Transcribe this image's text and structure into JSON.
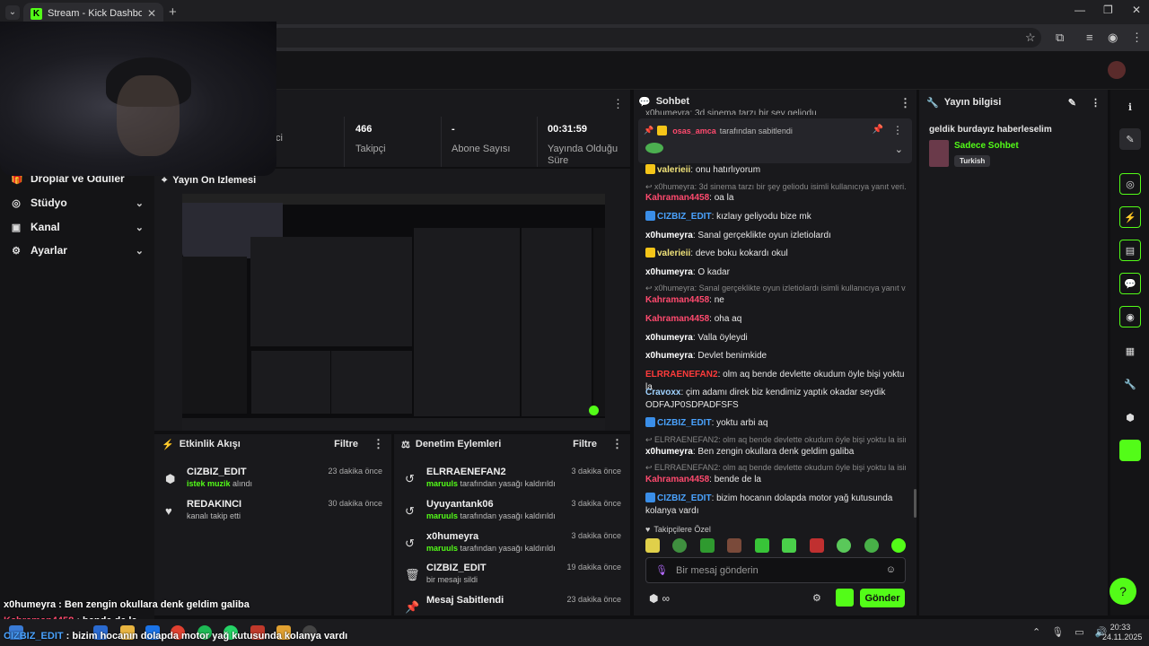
{
  "browser": {
    "tab_title": "Stream - Kick Dashboard",
    "new_tab": "+",
    "close": "✕"
  },
  "sidebar": {
    "items": [
      {
        "label": "Droplar ve Ödüller",
        "icon": "gift-icon"
      },
      {
        "label": "Stüdyo",
        "icon": "camera-icon"
      },
      {
        "label": "Kanal",
        "icon": "broadcast-icon"
      },
      {
        "label": "Ayarlar",
        "icon": "gear-icon"
      }
    ]
  },
  "stats": {
    "items": [
      {
        "value": "",
        "label": "İzleyici"
      },
      {
        "value": "466",
        "label": "Takipçi"
      },
      {
        "value": "-",
        "label": "Abone Sayısı"
      },
      {
        "value": "00:31:59",
        "label": "Yayında Olduğu Süre"
      }
    ]
  },
  "preview": {
    "title": "Yayın Ön İzlemesi"
  },
  "activity": {
    "title": "Etkinlik Akışı",
    "filter": "Filtre",
    "events": [
      {
        "name": "CIZBIZ_EDIT",
        "highlight": "istek muzik",
        "text": " alındı",
        "time": "23 dakika önce"
      },
      {
        "name": "REDAKINCI",
        "highlight": "",
        "text": "kanalı takip etti",
        "time": "30 dakika önce"
      }
    ]
  },
  "moderation": {
    "title": "Denetim Eylemleri",
    "filter": "Filtre",
    "events": [
      {
        "name": "ELRRAENEFAN2",
        "highlight": "maruuls",
        "text": " tarafından yasağı kaldırıldı",
        "time": "3 dakika önce"
      },
      {
        "name": "Uyuyantank06",
        "highlight": "maruuls",
        "text": " tarafından yasağı kaldırıldı",
        "time": "3 dakika önce"
      },
      {
        "name": "x0humeyra",
        "highlight": "maruuls",
        "text": " tarafından yasağı kaldırıldı",
        "time": "3 dakika önce"
      },
      {
        "name": "CIZBIZ_EDIT",
        "highlight": "",
        "text": "bir mesajı sildi",
        "time": "19 dakika önce"
      },
      {
        "name": "Mesaj Sabitlendi",
        "highlight": "",
        "text": "",
        "time": "23 dakika önce"
      }
    ]
  },
  "chat": {
    "title": "Sohbet",
    "pinned_user": "osas_amca",
    "pinned_text": "tarafından sabitlendi",
    "top_cut": "x0humeyra: 3d sinema tarzı bir şey geliodu",
    "messages": [
      {
        "user": "valerieii",
        "color": "#f1e37a",
        "text": ": onu hatırlıyorum",
        "badge": "crown"
      },
      {
        "reply": "x0humeyra: 3d sinema tarzı bir şey geliodu isimli kullanıcıya yanıt veri..."
      },
      {
        "user": "Kahraman4458",
        "color": "#ff4a6e",
        "text": ": oa la"
      },
      {
        "user": "CIZBIZ_EDIT",
        "color": "#4aa3ff",
        "text": ": kızlaıy geliyodu bize mk",
        "badge": "pencil"
      },
      {
        "user": "x0humeyra",
        "color": "#ffffff",
        "text": ": Sanal gerçeklikte oyun izletiolardı"
      },
      {
        "user": "valerieii",
        "color": "#f1e37a",
        "text": ": deve boku kokardı okul",
        "badge": "crown"
      },
      {
        "user": "x0humeyra",
        "color": "#ffffff",
        "text": ": O kadar"
      },
      {
        "reply": "x0humeyra: Sanal gerçeklikte oyun izletiolardı isimli kullanıcıya yanıt v..."
      },
      {
        "user": "Kahraman4458",
        "color": "#ff4a6e",
        "text": ": ne"
      },
      {
        "user": "Kahraman4458",
        "color": "#ff4a6e",
        "text": ": oha aq"
      },
      {
        "user": "x0humeyra",
        "color": "#ffffff",
        "text": ": Valla öyleydi"
      },
      {
        "user": "x0humeyra",
        "color": "#ffffff",
        "text": ": Devlet benimkide"
      },
      {
        "user": "ELRRAENEFAN2",
        "color": "#ff3b3b",
        "text": ": olm aq bende devlette okudum öyle bişi yoktu la"
      },
      {
        "user": "Cravoxx",
        "color": "#9fd2ff",
        "text": ": çim adamı direk biz kendimiz yaptık okadar seydik ODFAJP0SDPADFSFS"
      },
      {
        "user": "CIZBIZ_EDIT",
        "color": "#4aa3ff",
        "text": ": yoktu arbi aq",
        "badge": "pencil"
      },
      {
        "reply": "ELRRAENEFAN2: olm aq bende devlette okudum öyle bişi yoktu la isim..."
      },
      {
        "user": "x0humeyra",
        "color": "#ffffff",
        "text": ": Ben zengin okullara denk geldim galiba"
      },
      {
        "reply": "ELRRAENEFAN2: olm aq bende devlette okudum öyle bişi yoktu la isim..."
      },
      {
        "user": "Kahraman4458",
        "color": "#ff4a6e",
        "text": ": bende de la"
      },
      {
        "user": "CIZBIZ_EDIT",
        "color": "#4aa3ff",
        "text": ": bizim hocanın dolapda motor yağ kutusunda kolanya vardı",
        "badge": "pencil"
      }
    ],
    "emote_title": "Takipçilere Özel",
    "input_placeholder": "Bir mesaj gönderin",
    "send": "Gönder",
    "infinity": "∞"
  },
  "info": {
    "title": "Yayın bilgisi",
    "stream_title": "geldik burdayız haberleselim",
    "category": "Sadece Sohbet",
    "tag": "Turkish"
  },
  "overlay": {
    "lines": [
      {
        "user": "x0humeyra",
        "text": " : Ben zengin okullara denk geldim galiba"
      },
      {
        "user": "Kahraman4458",
        "text": " : bende de la"
      },
      {
        "user": "CIZBIZ_EDIT",
        "text": " : bizim hocanın dolapda motor yağ kutusunda kolanya vardı"
      }
    ]
  },
  "taskbar": {
    "time": "20:33",
    "date": "24.11.2025"
  }
}
